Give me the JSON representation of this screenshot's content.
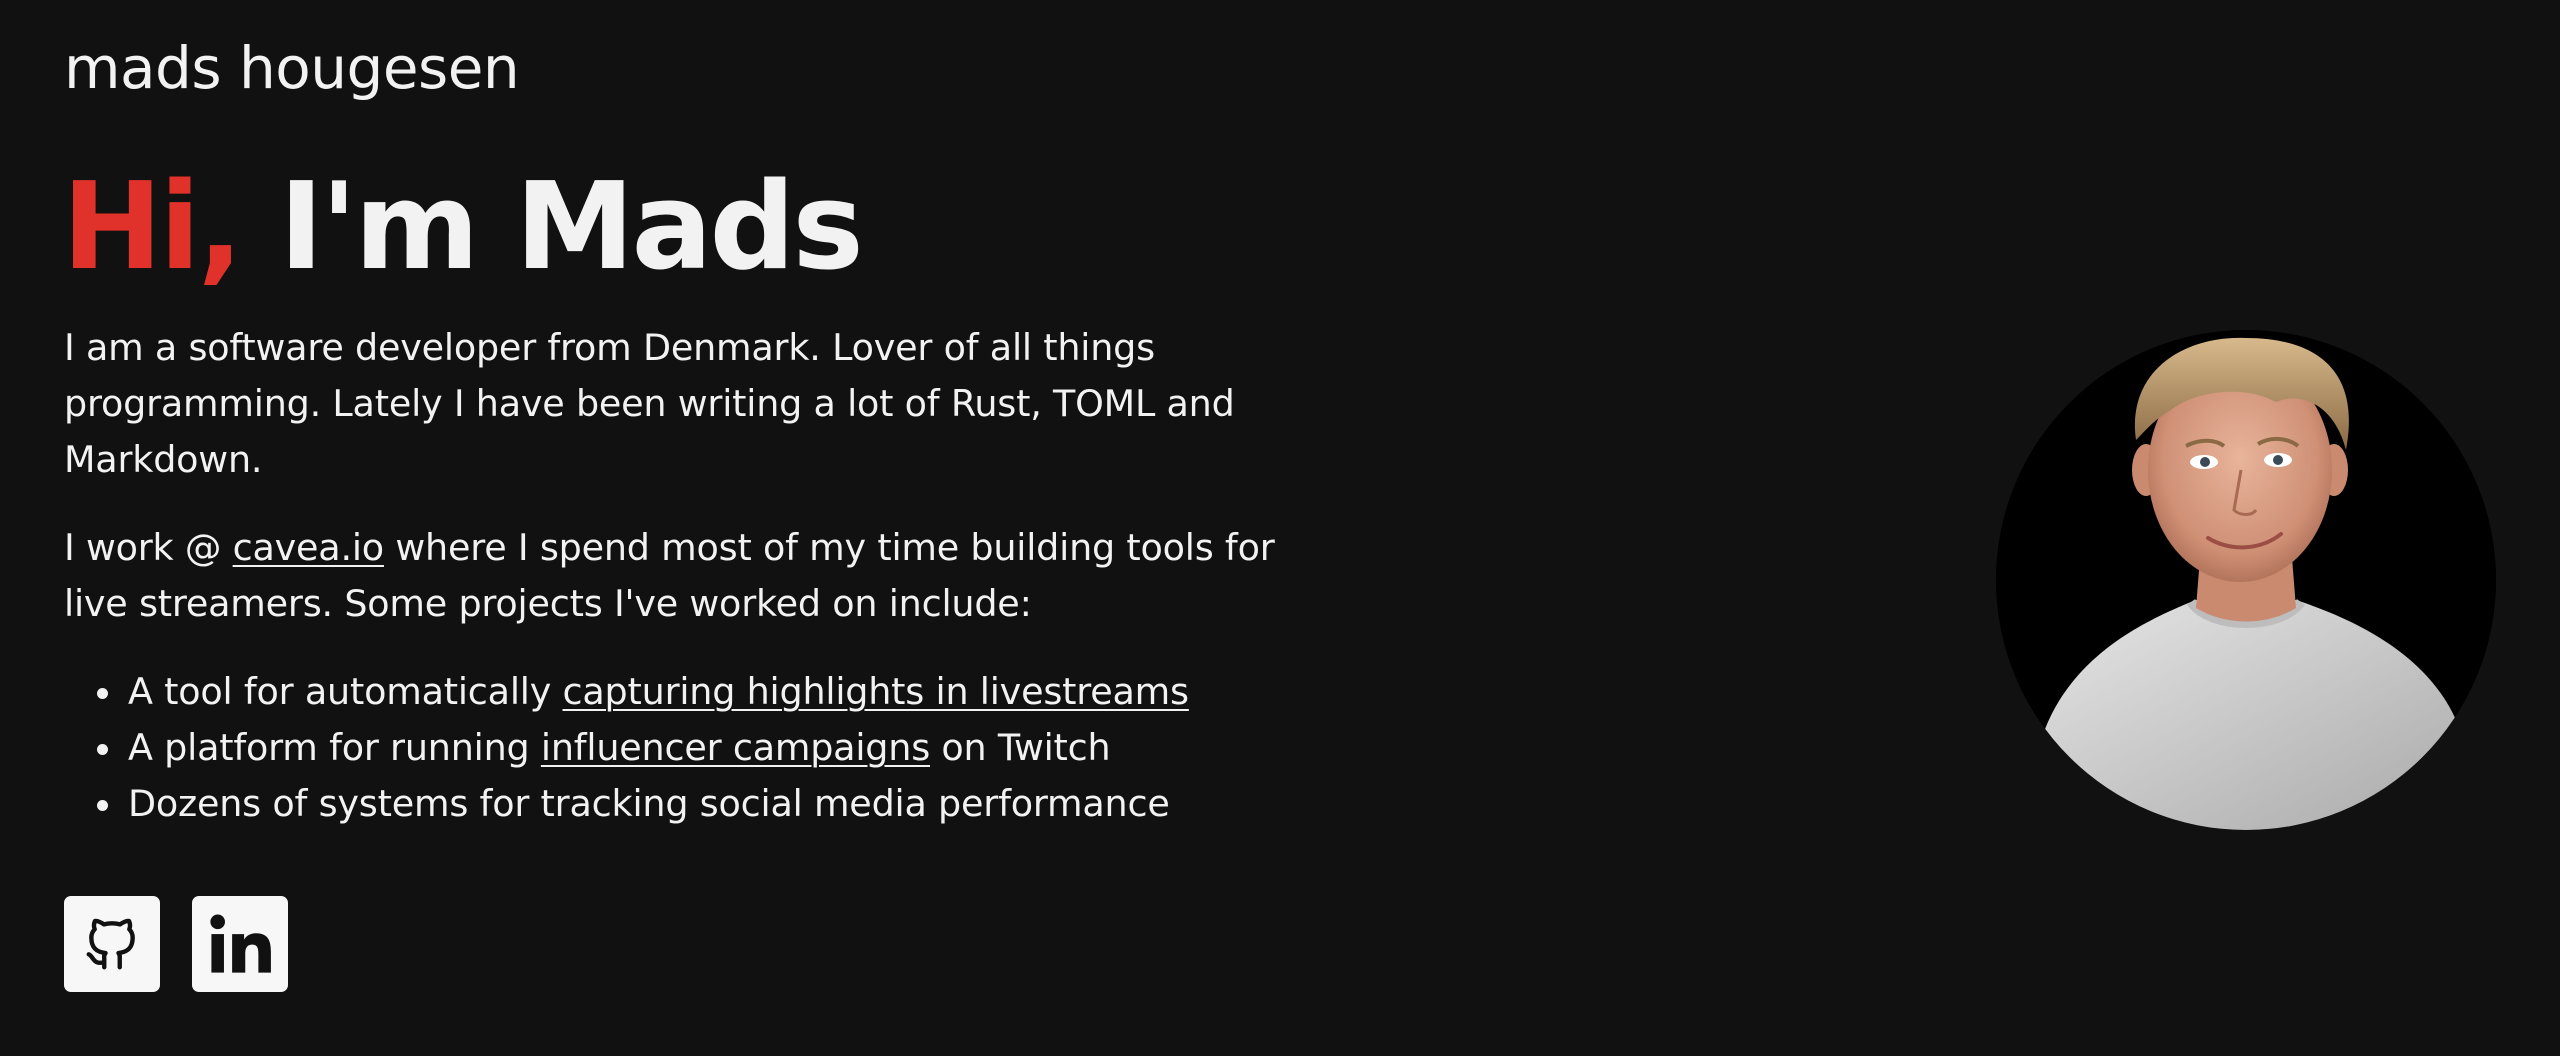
{
  "site": {
    "name": "mads hougesen"
  },
  "hero": {
    "greeting": "Hi,",
    "title_rest": "I'm Mads"
  },
  "intro": {
    "paragraph": "I am a software developer from Denmark. Lover of all things programming. Lately I have been writing a lot of Rust, TOML and Markdown."
  },
  "work": {
    "prefix": "I work @ ",
    "company_link": "cavea.io",
    "suffix": " where I spend most of my time building tools for live streamers. Some projects I've worked on include:"
  },
  "projects": [
    {
      "prefix": "A tool for automatically ",
      "link": "capturing highlights in livestreams",
      "suffix": ""
    },
    {
      "prefix": "A platform for running ",
      "link": "influencer campaigns",
      "suffix": " on Twitch"
    },
    {
      "prefix": "Dozens of systems for tracking social media performance",
      "link": "",
      "suffix": ""
    }
  ],
  "social": {
    "github_icon": "github-icon",
    "linkedin_icon": "linkedin-icon"
  },
  "colors": {
    "background": "#111111",
    "text": "#f2f2f2",
    "accent": "#e0322a"
  }
}
